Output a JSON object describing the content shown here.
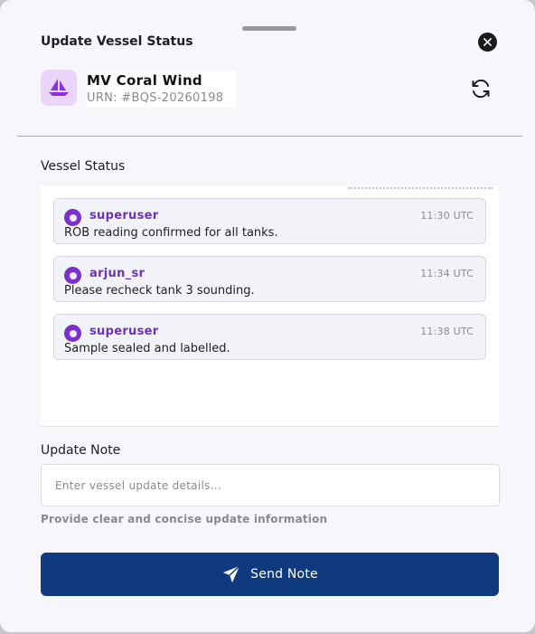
{
  "header": {
    "title": "Update Vessel Status",
    "close_icon": "close-icon"
  },
  "vessel": {
    "name": "MV Coral Wind",
    "urn": "URN: #BQS-20260198",
    "icon": "sailboat-icon",
    "badge_color": "#ead6fa",
    "icon_color": "#8b2fe0"
  },
  "status_section": {
    "label": "Vessel Status",
    "messages": [
      {
        "user": "superuser",
        "time": "11:30 UTC",
        "text": "ROB reading confirmed for all tanks."
      },
      {
        "user": "arjun_sr",
        "time": "11:34 UTC",
        "text": "Please recheck tank 3 sounding."
      },
      {
        "user": "superuser",
        "time": "11:38 UTC",
        "text": "Sample sealed and labelled."
      }
    ]
  },
  "note_section": {
    "label": "Update Note",
    "placeholder": "Enter vessel update details...",
    "value": "",
    "helper": "Provide clear and concise update information"
  },
  "send_button": {
    "label": "Send Note",
    "icon": "send-icon",
    "color": "#0f3a80"
  }
}
